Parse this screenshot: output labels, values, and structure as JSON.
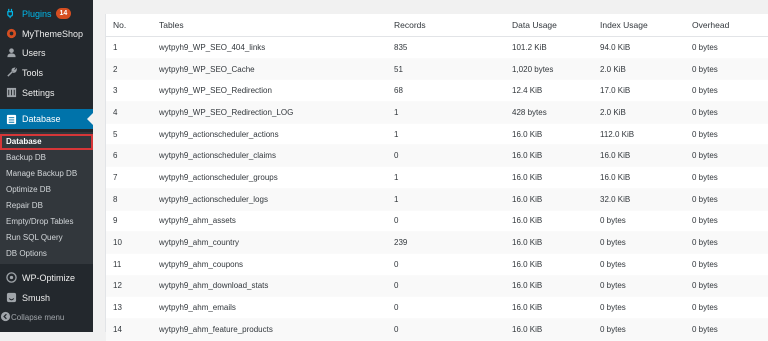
{
  "sidebar": {
    "plugins": {
      "label": "Plugins",
      "badge": "14"
    },
    "items": [
      {
        "label": "MyThemeShop"
      },
      {
        "label": "Users"
      },
      {
        "label": "Tools"
      },
      {
        "label": "Settings"
      }
    ],
    "database": {
      "label": "Database"
    },
    "submenu": [
      {
        "label": "Database"
      },
      {
        "label": "Backup DB"
      },
      {
        "label": "Manage Backup DB"
      },
      {
        "label": "Optimize DB"
      },
      {
        "label": "Repair DB"
      },
      {
        "label": "Empty/Drop Tables"
      },
      {
        "label": "Run SQL Query"
      },
      {
        "label": "DB Options"
      }
    ],
    "bottom_items": [
      {
        "label": "WP-Optimize"
      },
      {
        "label": "Smush"
      }
    ],
    "collapse_label": "Collapse menu"
  },
  "table": {
    "headers": [
      "No.",
      "Tables",
      "Records",
      "Data Usage",
      "Index Usage",
      "Overhead"
    ],
    "rows": [
      [
        "1",
        "wytpyh9_WP_SEO_404_links",
        "835",
        "101.2 KiB",
        "94.0 KiB",
        "0 bytes"
      ],
      [
        "2",
        "wytpyh9_WP_SEO_Cache",
        "51",
        "1,020 bytes",
        "2.0 KiB",
        "0 bytes"
      ],
      [
        "3",
        "wytpyh9_WP_SEO_Redirection",
        "68",
        "12.4 KiB",
        "17.0 KiB",
        "0 bytes"
      ],
      [
        "4",
        "wytpyh9_WP_SEO_Redirection_LOG",
        "1",
        "428 bytes",
        "2.0 KiB",
        "0 bytes"
      ],
      [
        "5",
        "wytpyh9_actionscheduler_actions",
        "1",
        "16.0 KiB",
        "112.0 KiB",
        "0 bytes"
      ],
      [
        "6",
        "wytpyh9_actionscheduler_claims",
        "0",
        "16.0 KiB",
        "16.0 KiB",
        "0 bytes"
      ],
      [
        "7",
        "wytpyh9_actionscheduler_groups",
        "1",
        "16.0 KiB",
        "16.0 KiB",
        "0 bytes"
      ],
      [
        "8",
        "wytpyh9_actionscheduler_logs",
        "1",
        "16.0 KiB",
        "32.0 KiB",
        "0 bytes"
      ],
      [
        "9",
        "wytpyh9_ahm_assets",
        "0",
        "16.0 KiB",
        "0 bytes",
        "0 bytes"
      ],
      [
        "10",
        "wytpyh9_ahm_country",
        "239",
        "16.0 KiB",
        "0 bytes",
        "0 bytes"
      ],
      [
        "11",
        "wytpyh9_ahm_coupons",
        "0",
        "16.0 KiB",
        "0 bytes",
        "0 bytes"
      ],
      [
        "12",
        "wytpyh9_ahm_download_stats",
        "0",
        "16.0 KiB",
        "0 bytes",
        "0 bytes"
      ],
      [
        "13",
        "wytpyh9_ahm_emails",
        "0",
        "16.0 KiB",
        "0 bytes",
        "0 bytes"
      ],
      [
        "14",
        "wytpyh9_ahm_feature_products",
        "0",
        "16.0 KiB",
        "0 bytes",
        "0 bytes"
      ]
    ]
  },
  "colors": {
    "sidebar_bg": "#23282d",
    "submenu_bg": "#32373c",
    "active_bg": "#0073aa",
    "badge_bg": "#d54e21",
    "highlight_border": "#d63638"
  }
}
